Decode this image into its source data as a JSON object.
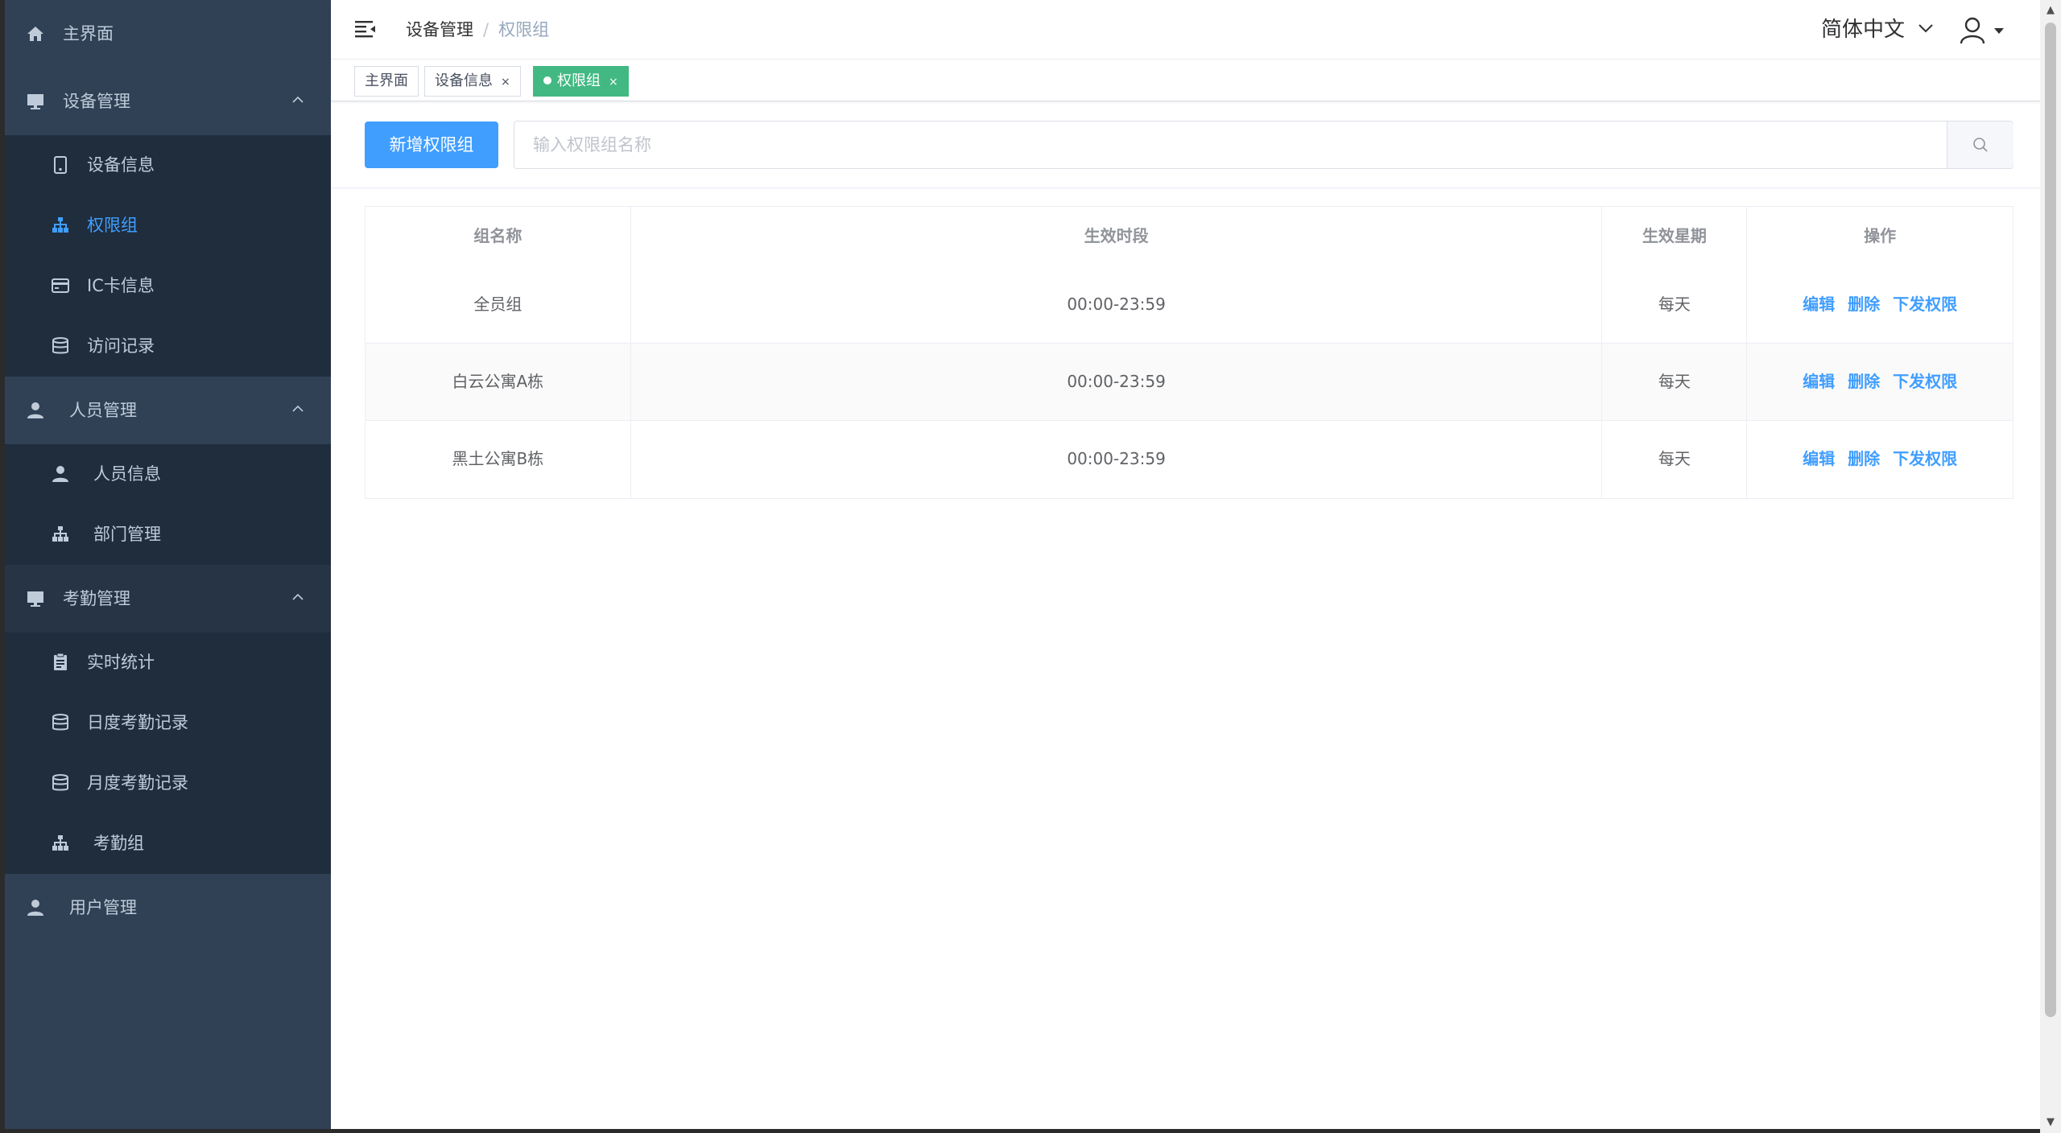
{
  "sidebar": {
    "home": "主界面",
    "device_mgmt": {
      "label": "设备管理",
      "items": [
        "设备信息",
        "权限组",
        "IC卡信息",
        "访问记录"
      ]
    },
    "people_mgmt": {
      "label": "人员管理",
      "items": [
        "人员信息",
        "部门管理"
      ]
    },
    "attendance_mgmt": {
      "label": "考勤管理",
      "items": [
        "实时统计",
        "日度考勤记录",
        "月度考勤记录",
        "考勤组"
      ]
    },
    "user_mgmt": "用户管理",
    "active_item": "权限组",
    "colors": {
      "bg": "#304156",
      "submenu_bg": "#1f2d3d",
      "text": "#bfcbd9",
      "active": "#409eff"
    }
  },
  "navbar": {
    "breadcrumb": [
      "设备管理",
      "权限组"
    ],
    "separator": "/",
    "language": "简体中文"
  },
  "tags": [
    {
      "label": "主界面",
      "closable": false,
      "active": false
    },
    {
      "label": "设备信息",
      "closable": true,
      "active": false
    },
    {
      "label": "权限组",
      "closable": true,
      "active": true
    }
  ],
  "tag_close_glyph": "×",
  "toolbar": {
    "add_button": "新增权限组",
    "search_placeholder": "输入权限组名称",
    "search_value": ""
  },
  "table": {
    "columns": [
      "组名称",
      "生效时段",
      "生效星期",
      "操作"
    ],
    "rows": [
      {
        "name": "全员组",
        "period": "00:00-23:59",
        "weekday": "每天"
      },
      {
        "name": "白云公寓A栋",
        "period": "00:00-23:59",
        "weekday": "每天"
      },
      {
        "name": "黑土公寓B栋",
        "period": "00:00-23:59",
        "weekday": "每天"
      }
    ],
    "actions": {
      "edit": "编辑",
      "delete": "删除",
      "issue": "下发权限"
    }
  },
  "colors": {
    "primary": "#409eff",
    "tag_active": "#42b983"
  }
}
